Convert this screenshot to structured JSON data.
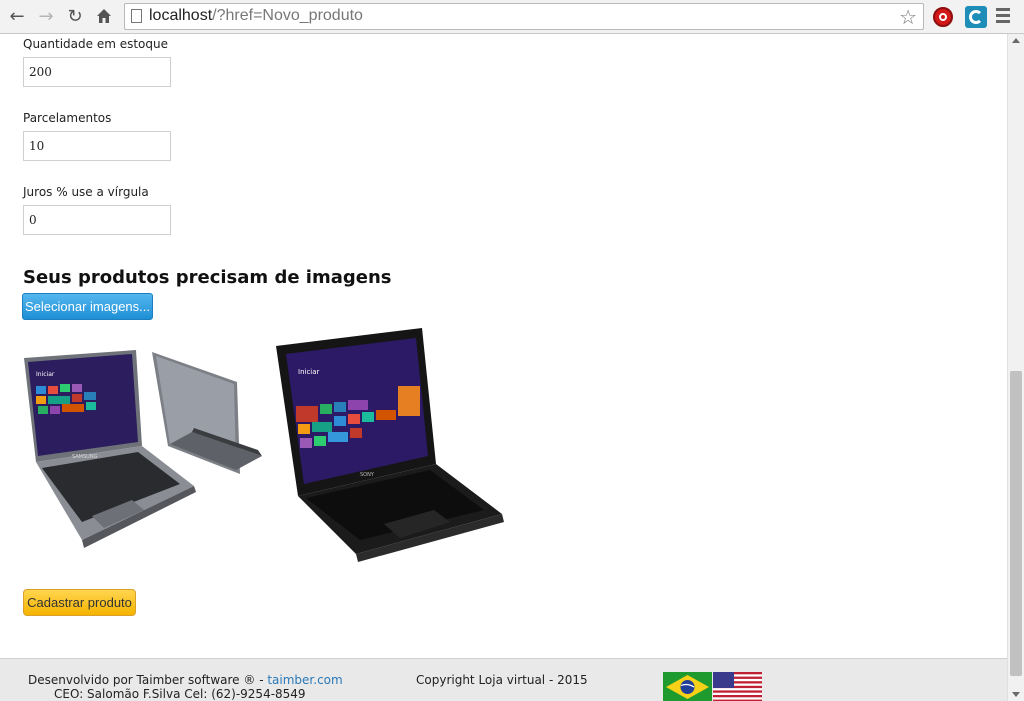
{
  "browser": {
    "url_host": "localhost",
    "url_path": "/?href=Novo_produto"
  },
  "form": {
    "stock_label": "Quantidade em estoque",
    "stock_value": "200",
    "installments_label": "Parcelamentos",
    "installments_value": "10",
    "interest_label": "Juros % use a vírgula",
    "interest_value": "0"
  },
  "images_section": {
    "title": "Seus produtos precisam de imagens",
    "select_button": "Selecionar imagens...",
    "images": [
      {
        "name": "Samsung laptop",
        "screen_label": "Iniciar",
        "brand": "SAMSUNG"
      },
      {
        "name": "Sony laptop",
        "screen_label": "Iniciar",
        "brand": "SONY"
      }
    ]
  },
  "submit_button": "Cadastrar produto",
  "footer": {
    "dev_prefix": "Desenvolvido por Taimber software ® - ",
    "dev_link": "taimber.com",
    "ceo": "CEO: Salomão F.Silva Cel: (62)-9254-8549",
    "copyright": "Copyright Loja virtual - 2015",
    "flags": [
      "brazil-flag",
      "usa-flag"
    ]
  },
  "colors": {
    "select_button": "#2a9fe0",
    "submit_button": "#fbc020",
    "link": "#2a79b8",
    "footer_bg": "#e9e9e9"
  }
}
